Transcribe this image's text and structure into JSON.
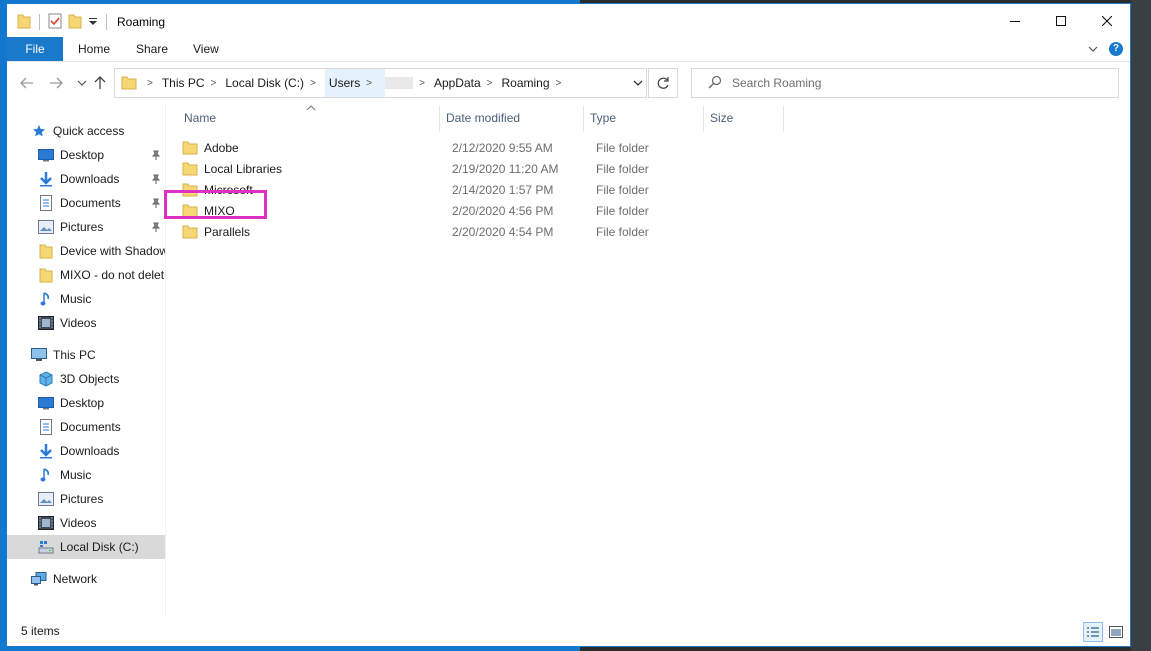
{
  "window": {
    "title": "Roaming",
    "controls": [
      "minimize-icon",
      "maximize-icon",
      "close-icon"
    ]
  },
  "ribbon": {
    "tabs": [
      {
        "label": "File"
      },
      {
        "label": "Home"
      },
      {
        "label": "Share"
      },
      {
        "label": "View"
      }
    ],
    "help_label": "?"
  },
  "address_bar": {
    "crumbs": [
      {
        "label": "This PC"
      },
      {
        "label": "Local Disk (C:)"
      },
      {
        "label": "Users"
      },
      {
        "label": ""
      },
      {
        "label": "AppData"
      },
      {
        "label": "Roaming"
      }
    ]
  },
  "search": {
    "placeholder": "Search Roaming"
  },
  "sidebar": {
    "quick_access": {
      "label": "Quick access",
      "items": [
        {
          "label": "Desktop",
          "icon": "desktop-icon",
          "pinned": true
        },
        {
          "label": "Downloads",
          "icon": "downloads-icon",
          "pinned": true
        },
        {
          "label": "Documents",
          "icon": "documents-icon",
          "pinned": true
        },
        {
          "label": "Pictures",
          "icon": "pictures-icon",
          "pinned": true
        },
        {
          "label": "Device with Shadow",
          "icon": "folder-icon",
          "pinned": false
        },
        {
          "label": "MIXO - do not delet",
          "icon": "folder-icon",
          "pinned": false
        },
        {
          "label": "Music",
          "icon": "music-icon",
          "pinned": false
        },
        {
          "label": "Videos",
          "icon": "videos-icon",
          "pinned": false
        }
      ]
    },
    "this_pc": {
      "label": "This PC",
      "items": [
        {
          "label": "3D Objects",
          "icon": "3d-objects-icon"
        },
        {
          "label": "Desktop",
          "icon": "desktop-icon"
        },
        {
          "label": "Documents",
          "icon": "documents-icon"
        },
        {
          "label": "Downloads",
          "icon": "downloads-icon"
        },
        {
          "label": "Music",
          "icon": "music-icon"
        },
        {
          "label": "Pictures",
          "icon": "pictures-icon"
        },
        {
          "label": "Videos",
          "icon": "videos-icon"
        },
        {
          "label": "Local Disk (C:)",
          "icon": "local-disk-icon",
          "selected": true
        }
      ]
    },
    "network": {
      "label": "Network"
    }
  },
  "file_list": {
    "columns": [
      "Name",
      "Date modified",
      "Type",
      "Size"
    ],
    "rows": [
      {
        "name": "Adobe",
        "date": "2/12/2020 9:55 AM",
        "type": "File folder"
      },
      {
        "name": "Local Libraries",
        "date": "2/19/2020 11:20 AM",
        "type": "File folder"
      },
      {
        "name": "Microsoft",
        "date": "2/14/2020 1:57 PM",
        "type": "File folder"
      },
      {
        "name": "MIXO",
        "date": "2/20/2020 4:56 PM",
        "type": "File folder",
        "highlighted": true
      },
      {
        "name": "Parallels",
        "date": "2/20/2020 4:54 PM",
        "type": "File folder"
      }
    ]
  },
  "status": {
    "item_count": "5 items"
  },
  "colors": {
    "accent": "#1979ca",
    "highlight_box": "#e02fc3",
    "folder": "#f7d774"
  }
}
